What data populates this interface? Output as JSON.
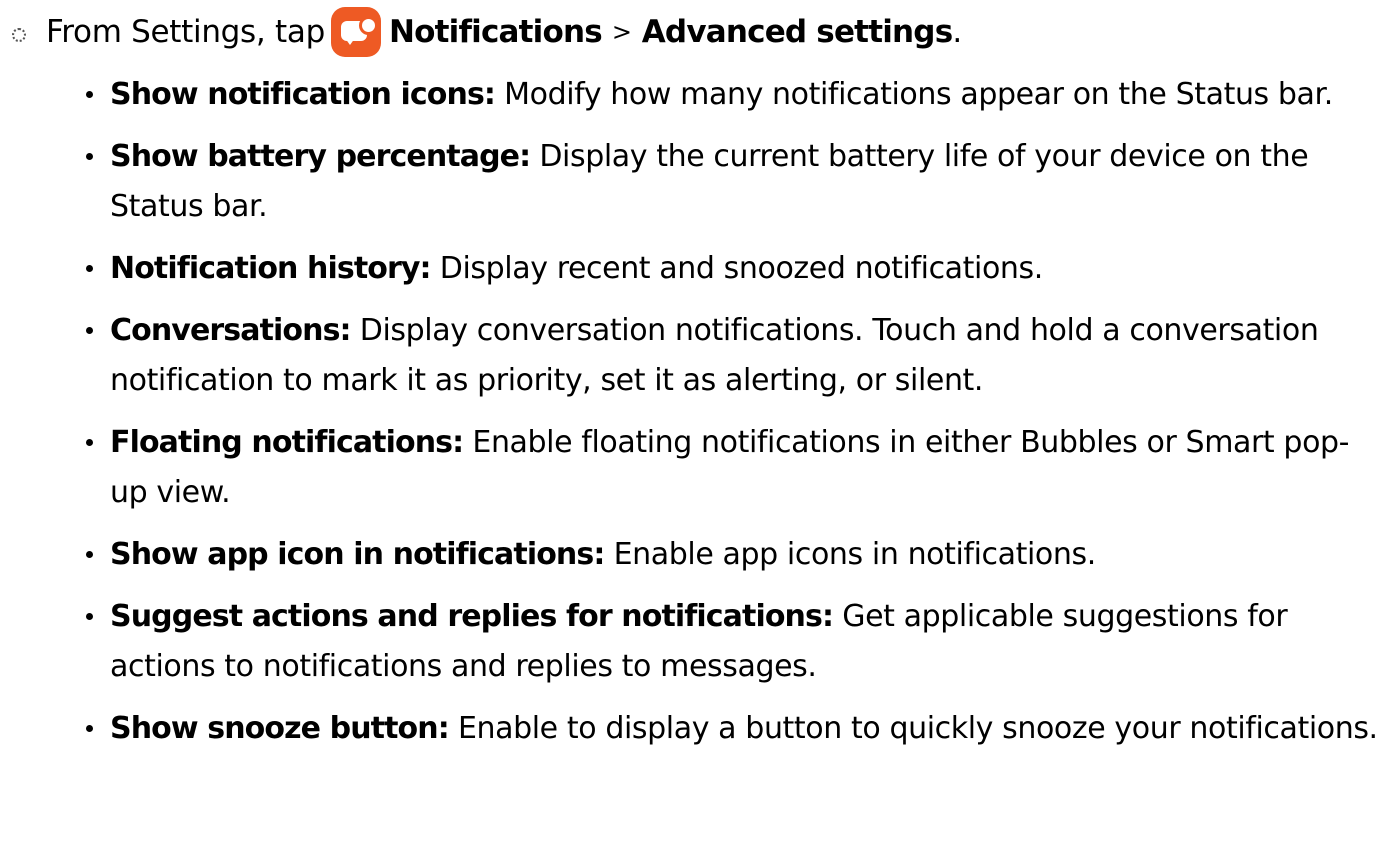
{
  "intro": {
    "prefix": "From Settings, tap",
    "menu_item": "Notifications",
    "separator": ">",
    "submenu_item": "Advanced settings",
    "suffix": ".",
    "icon": "notifications-app-icon",
    "icon_color": "#ee5a24"
  },
  "items": [
    {
      "term": "Show notification icons",
      "colon": ":",
      "description": " Modify how many notifications appear on the Status bar."
    },
    {
      "term": "Show battery percentage",
      "colon": ":",
      "description": " Display the current battery life of your device on the Status bar."
    },
    {
      "term": "Notification history",
      "colon": ":",
      "description": " Display recent and snoozed notifications."
    },
    {
      "term": "Conversations",
      "colon": ":",
      "description": " Display conversation notifications. Touch and hold a conversation notification to mark it as priority, set it as alerting, or silent."
    },
    {
      "term": "Floating notifications",
      "colon": ":",
      "description": " Enable floating notifications in either Bubbles or Smart pop-up view."
    },
    {
      "term": "Show app icon in notifications",
      "colon": ":",
      "description": " Enable app icons in notifications."
    },
    {
      "term": "Suggest actions and replies for notifications",
      "colon": ":",
      "description": " Get applicable suggestions for actions to notifications and replies to messages."
    },
    {
      "term": "Show snooze button",
      "colon": ":",
      "description": " Enable to display a button to quickly snooze your notifications."
    }
  ]
}
